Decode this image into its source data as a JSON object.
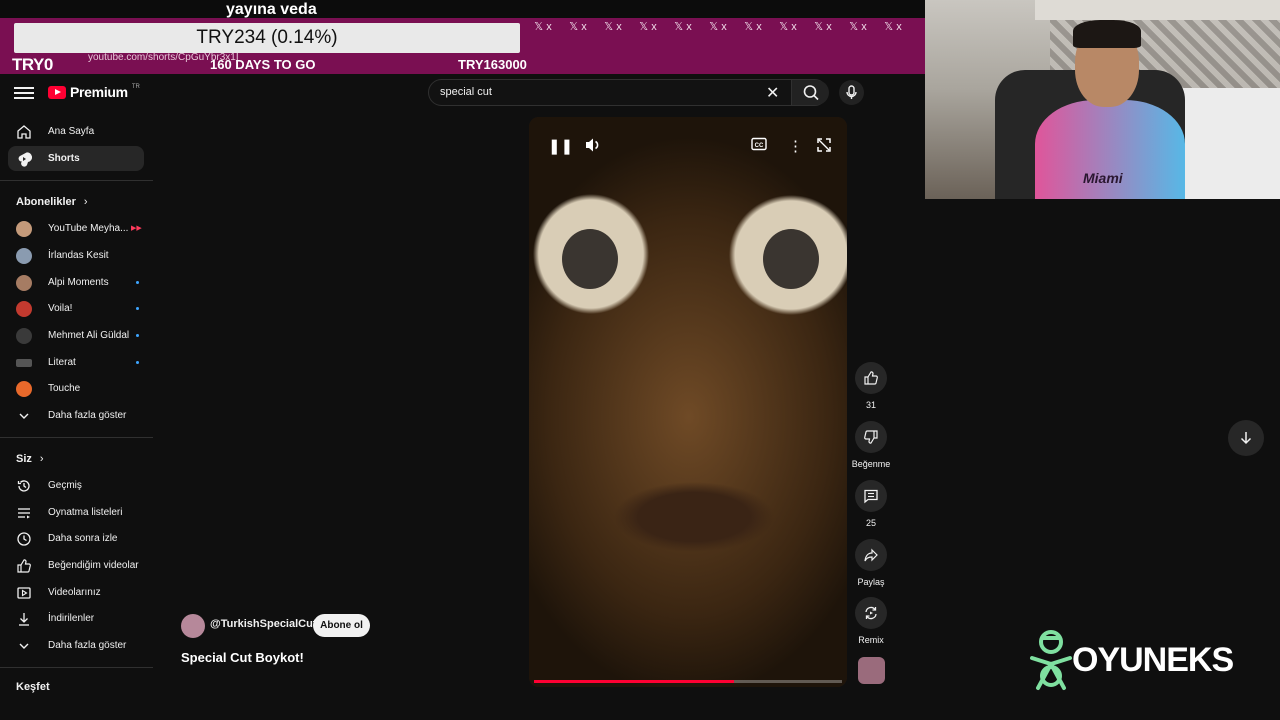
{
  "overlay": {
    "top_text": "yayına veda",
    "goal_text": "TRY234 (0.14%)",
    "current_amount": "TRY0",
    "days_left": "160 DAYS TO GO",
    "goal_target": "TRY163000",
    "url": "youtube.com/shorts/CpGuYbr3x1I",
    "x_marks": [
      "𝕏 x",
      "𝕏 x",
      "𝕏 x",
      "𝕏 x",
      "𝕏 x",
      "𝕏 x",
      "𝕏 x",
      "𝕏 x",
      "𝕏 x",
      "𝕏 x",
      "𝕏 x"
    ]
  },
  "header": {
    "logo_text": "Premium",
    "logo_region": "TR",
    "search_query": "special cut"
  },
  "sidebar": {
    "main": [
      {
        "label": "Ana Sayfa",
        "icon": "home-icon"
      },
      {
        "label": "Shorts",
        "icon": "shorts-icon",
        "active": true
      }
    ],
    "subscriptions_title": "Abonelikler",
    "subscriptions": [
      {
        "label": "YouTube Meyha...",
        "color": "#c49a7a",
        "live": true
      },
      {
        "label": "İrlandas Kesit",
        "color": "#8a9bb0"
      },
      {
        "label": "Alpi Moments",
        "color": "#a67c63",
        "new": true
      },
      {
        "label": "Voila!",
        "color": "#c23a2f",
        "new": true
      },
      {
        "label": "Mehmet Ali Güldal",
        "color": "#3a3a3a",
        "new": true
      },
      {
        "label": "Literat",
        "color": "#555555",
        "new": true
      },
      {
        "label": "Touche",
        "color": "#e8692b"
      }
    ],
    "show_more_1": "Daha fazla göster",
    "you_title": "Siz",
    "you_items": [
      {
        "label": "Geçmiş",
        "icon": "history-icon"
      },
      {
        "label": "Oynatma listeleri",
        "icon": "playlists-icon"
      },
      {
        "label": "Daha sonra izle",
        "icon": "watch-later-icon"
      },
      {
        "label": "Beğendiğim videolar",
        "icon": "liked-videos-icon"
      },
      {
        "label": "Videolarınız",
        "icon": "your-videos-icon"
      },
      {
        "label": "İndirilenler",
        "icon": "downloads-icon"
      }
    ],
    "show_more_2": "Daha fazla göster",
    "explore_title": "Keşfet"
  },
  "video": {
    "channel": "@TurkishSpecialCut",
    "subscribe_label": "Abone ol",
    "title": "Special Cut Boykot!",
    "progress": 0.65
  },
  "actions": {
    "like_count": "31",
    "dislike_label": "Beğenme",
    "comment_count": "25",
    "share_label": "Paylaş",
    "remix_label": "Remix"
  },
  "webcam": {
    "jersey_text": "Miami"
  },
  "brand": {
    "name": "OYUNEKS",
    "color": "#7fe0a0"
  }
}
